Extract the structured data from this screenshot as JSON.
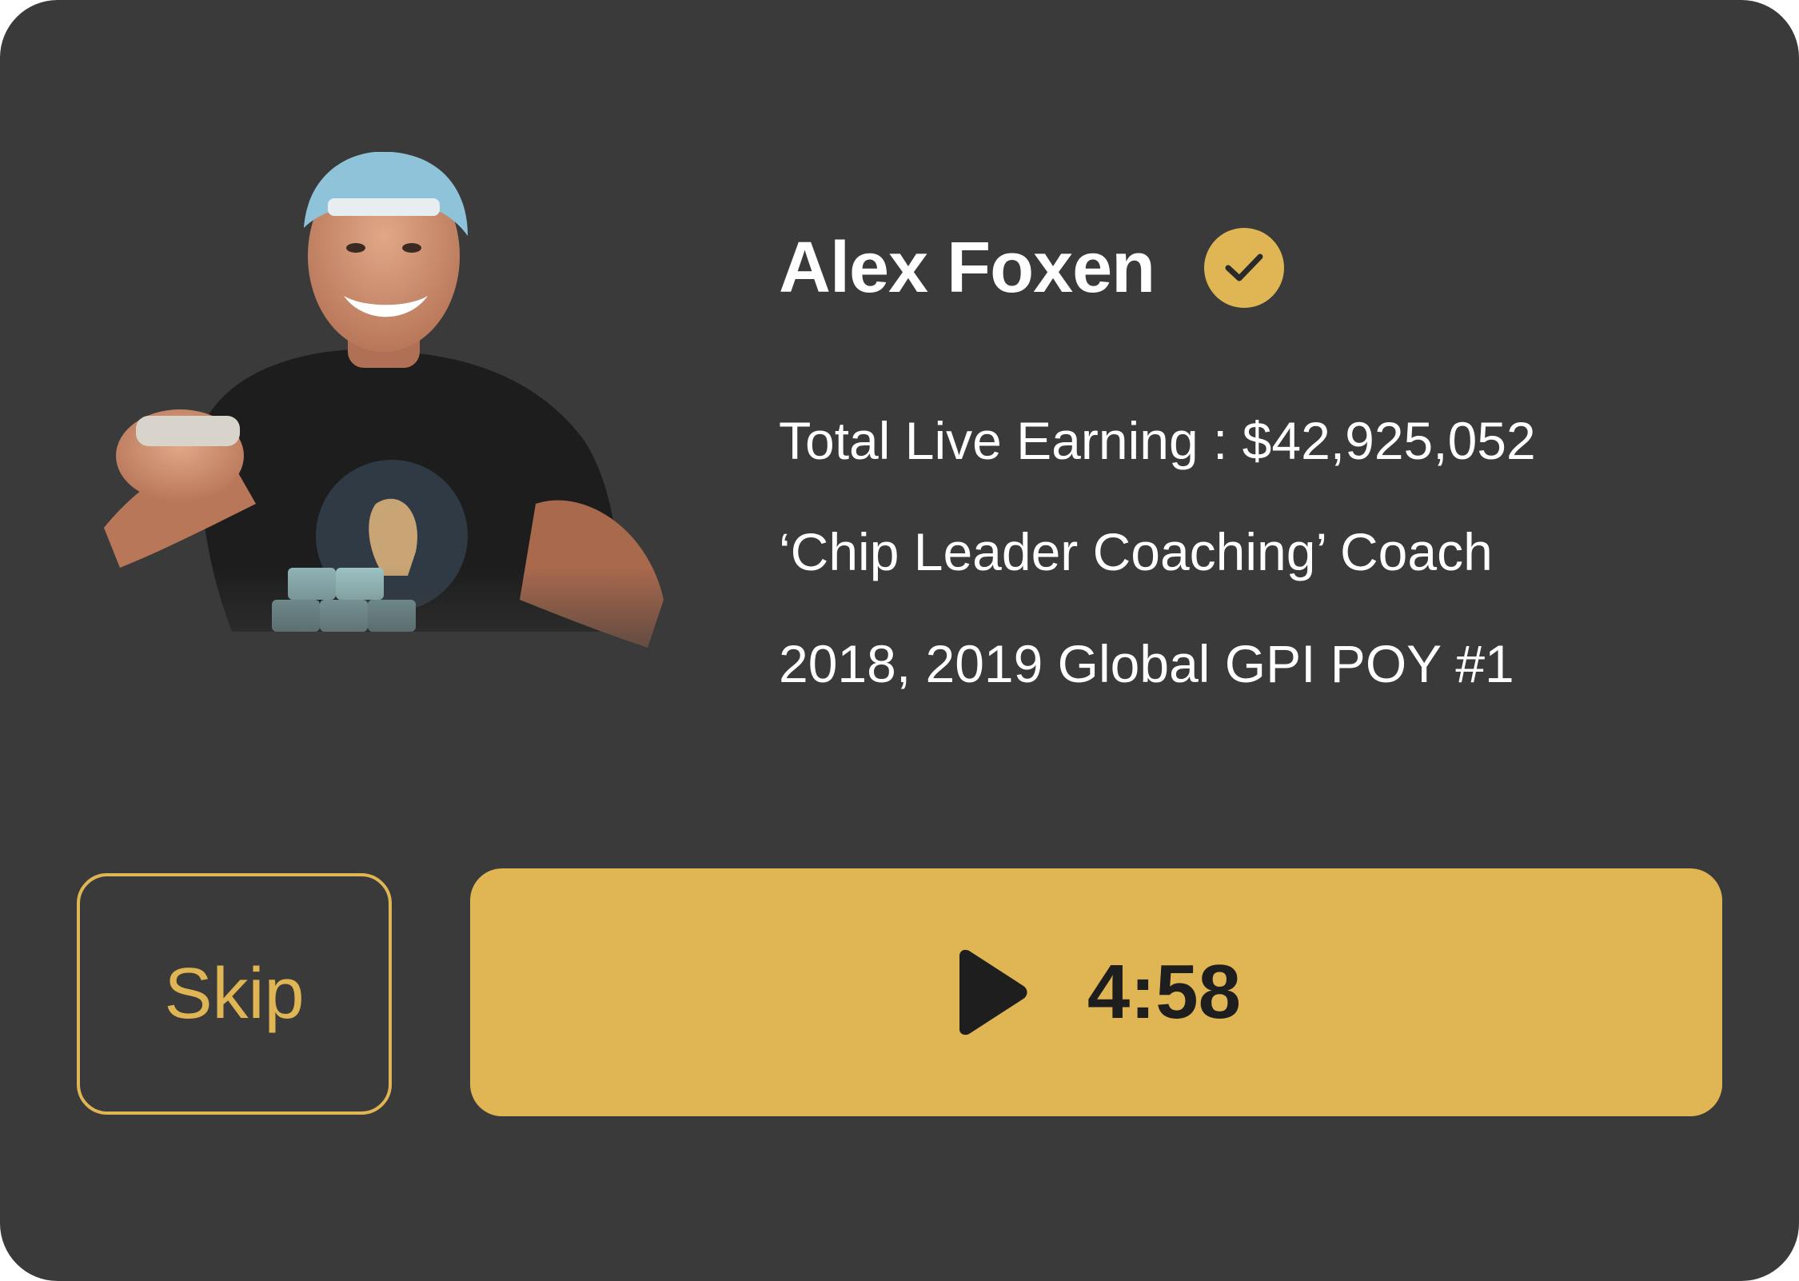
{
  "coach": {
    "name": "Alex Foxen",
    "verified_icon": "check-circle-icon",
    "stats": [
      "Total Live Earning : $42,925,052",
      "‘Chip Leader Coaching’ Coach",
      "2018, 2019 Global GPI POY #1"
    ],
    "photo_icon": "coach-photo"
  },
  "actions": {
    "skip_label": "Skip",
    "play_icon": "play-icon",
    "timer": "4:58"
  },
  "colors": {
    "background": "#3a3a3a",
    "accent": "#e0b655",
    "text": "#ffffff",
    "button_text": "#1e1e1e"
  }
}
